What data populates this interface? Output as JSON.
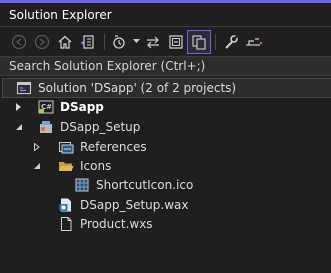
{
  "window": {
    "title": "Solution Explorer"
  },
  "toolbar": {
    "buttons": [
      {
        "icon": "back-arrow-icon"
      },
      {
        "icon": "forward-arrow-icon"
      },
      {
        "icon": "home-icon"
      },
      {
        "icon": "switch-views-icon"
      },
      {
        "icon": "pending-changes-filter-icon"
      },
      {
        "icon": "sync-with-active-document-icon"
      },
      {
        "icon": "collapse-all-icon"
      },
      {
        "icon": "show-all-files-icon"
      },
      {
        "icon": "properties-icon"
      },
      {
        "icon": "preview-selected-items-icon"
      }
    ]
  },
  "search": {
    "placeholder": "Search Solution Explorer (Ctrl+;)"
  },
  "tree": {
    "solution": {
      "label": "Solution 'DSapp' (2 of 2 projects)",
      "icon": "solution-icon"
    },
    "dsapp": {
      "label": "DSapp",
      "icon": "csharp-project-icon",
      "expanded": false
    },
    "setup": {
      "label": "DSapp_Setup",
      "icon": "setup-project-icon",
      "expanded": true
    },
    "references": {
      "label": "References",
      "icon": "references-icon",
      "expanded": false
    },
    "icons_folder": {
      "label": "Icons",
      "icon": "open-folder-icon",
      "expanded": true
    },
    "shortcut_icon": {
      "label": "ShortcutIcon.ico",
      "icon": "image-file-icon"
    },
    "wax_file": {
      "label": "DSapp_Setup.wax",
      "icon": "wax-file-icon"
    },
    "product_file": {
      "label": "Product.wxs",
      "icon": "document-icon"
    }
  },
  "colors": {
    "accent": "#7160e8",
    "background": "#1f1f1f"
  }
}
